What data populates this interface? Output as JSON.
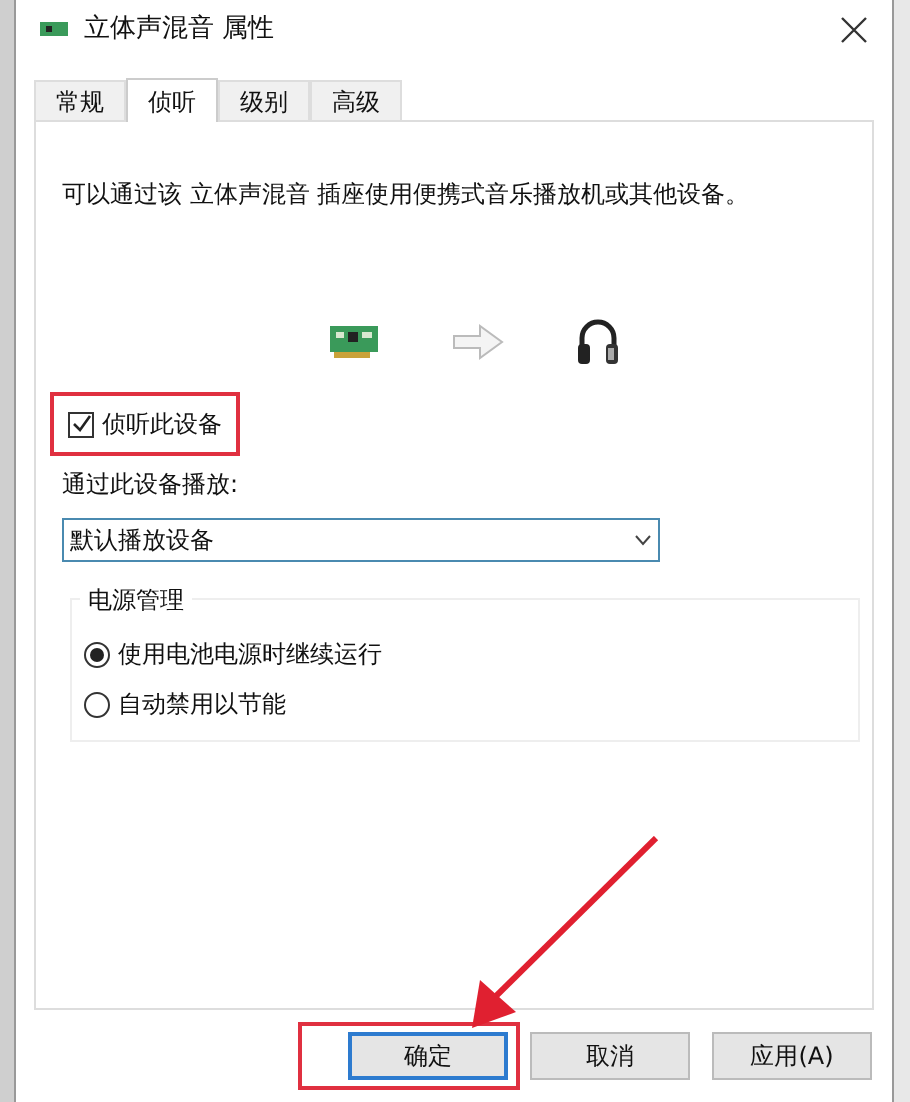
{
  "window": {
    "title": "立体声混音 属性"
  },
  "tabs": [
    {
      "label": "常规",
      "selected": false
    },
    {
      "label": "侦听",
      "selected": true
    },
    {
      "label": "级别",
      "selected": false
    },
    {
      "label": "高级",
      "selected": false
    }
  ],
  "description": "可以通过该 立体声混音 插座使用便携式音乐播放机或其他设备。",
  "listen_checkbox": {
    "label": "侦听此设备",
    "checked": true,
    "highlighted": true
  },
  "playback": {
    "label": "通过此设备播放:",
    "value": "默认播放设备"
  },
  "power": {
    "title": "电源管理",
    "options": [
      {
        "label": "使用电池电源时继续运行",
        "selected": true
      },
      {
        "label": "自动禁用以节能",
        "selected": false
      }
    ]
  },
  "buttons": [
    {
      "label": "确定",
      "highlighted": true
    },
    {
      "label": "取消",
      "highlighted": false
    },
    {
      "label": "应用(A)",
      "highlighted": false
    }
  ]
}
